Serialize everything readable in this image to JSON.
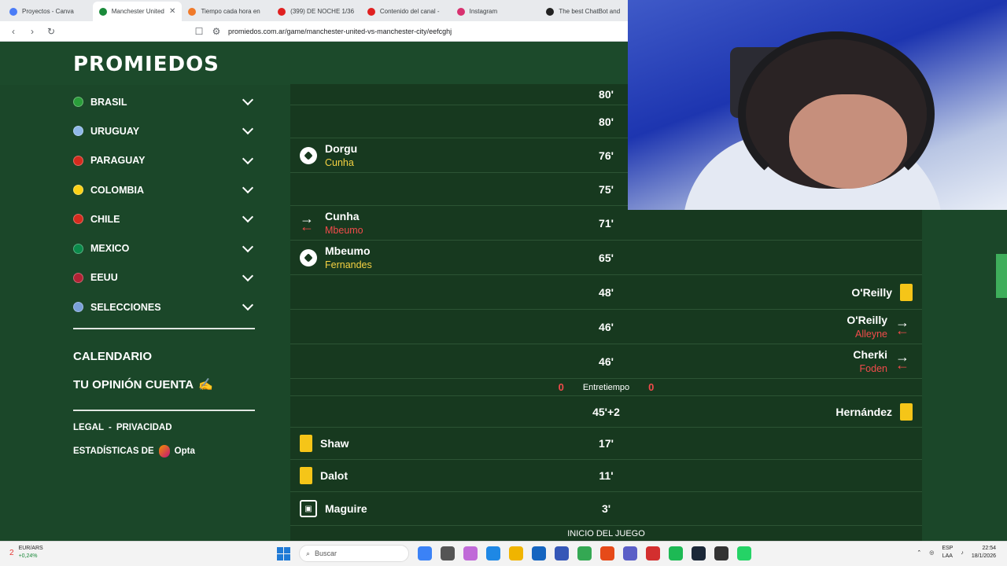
{
  "browser": {
    "tabs": [
      {
        "label": "Proyectos - Canva",
        "color": "#4a7cf7",
        "active": false
      },
      {
        "label": "Manchester United",
        "color": "#1a8a3a",
        "active": true
      },
      {
        "label": "Tiempo cada hora en",
        "color": "#f07a2a",
        "active": false
      },
      {
        "label": "(399) DE NOCHE 1/36",
        "color": "#e02020",
        "active": false
      },
      {
        "label": "Contenido del canal -",
        "color": "#e02020",
        "active": false
      },
      {
        "label": "Instagram",
        "color": "#d8316f",
        "active": false
      },
      {
        "label": "The best ChatBot and",
        "color": "#222222",
        "active": false
      }
    ],
    "close_glyph": "✕",
    "url": "promiedos.com.ar/game/manchester-united-vs-manchester-city/eefcghj"
  },
  "logo": "PROMIEDOS",
  "sidebar": {
    "countries": [
      {
        "label": "BRASIL",
        "flag": "#2a9d3a"
      },
      {
        "label": "URUGUAY",
        "flag": "#8fb8e8"
      },
      {
        "label": "PARAGUAY",
        "flag": "#d52b1e"
      },
      {
        "label": "COLOMBIA",
        "flag": "#fcd116"
      },
      {
        "label": "CHILE",
        "flag": "#d52b1e"
      },
      {
        "label": "MEXICO",
        "flag": "#0b8a4a"
      },
      {
        "label": "EEUU",
        "flag": "#b22234"
      },
      {
        "label": "SELECCIONES",
        "flag": "#7aa0d8"
      }
    ],
    "calendario": "CALENDARIO",
    "opinion": "TU OPINIÓN CUENTA",
    "opinion_emoji": "✍",
    "legal": "LEGAL",
    "separator": "-",
    "privacidad": "PRIVACIDAD",
    "stats": "ESTADÍSTICAS DE",
    "opta": "Opta"
  },
  "events": [
    {
      "minute": "80'",
      "home": null,
      "away": null
    },
    {
      "minute": "80'",
      "home": null,
      "away": null
    },
    {
      "minute": "76'",
      "home": {
        "icon": "goal",
        "name": "Dorgu",
        "sub": "Cunha",
        "sub_color": "yellow"
      },
      "away": null
    },
    {
      "minute": "75'",
      "home": null,
      "away": null
    },
    {
      "minute": "71'",
      "home": {
        "icon": "sub",
        "name": "Cunha",
        "sub": "Mbeumo",
        "sub_color": "red"
      },
      "away": null
    },
    {
      "minute": "65'",
      "home": {
        "icon": "goal",
        "name": "Mbeumo",
        "sub": "Fernandes",
        "sub_color": "yellow"
      },
      "away": null
    },
    {
      "minute": "48'",
      "home": null,
      "away": {
        "icon": "card",
        "name": "O'Reilly",
        "sub": null
      }
    },
    {
      "minute": "46'",
      "home": null,
      "away": {
        "icon": "sub",
        "name": "O'Reilly",
        "sub": "Alleyne",
        "sub_color": "red"
      }
    },
    {
      "minute": "46'",
      "home": null,
      "away": {
        "icon": "sub",
        "name": "Cherki",
        "sub": "Foden",
        "sub_color": "red"
      }
    },
    {
      "halftime": true,
      "label": "Entretiempo",
      "home_score": "0",
      "away_score": "0"
    },
    {
      "minute": "45'+2",
      "home": null,
      "away": {
        "icon": "card",
        "name": "Hernández",
        "sub": null
      }
    },
    {
      "minute": "17'",
      "home": {
        "icon": "card",
        "name": "Shaw",
        "sub": null
      },
      "away": null
    },
    {
      "minute": "11'",
      "home": {
        "icon": "card",
        "name": "Dalot",
        "sub": null
      },
      "away": null
    },
    {
      "minute": "3'",
      "home": {
        "icon": "var",
        "name": "Maguire",
        "sub": null
      },
      "away": null
    }
  ],
  "start_label": "INICIO DEL JUEGO",
  "taskbar": {
    "ticker": "EUR/ARS",
    "ticker_change": "+0,24%",
    "badge": "2",
    "search": "Buscar",
    "lang_top": "ESP",
    "lang_bottom": "LAA",
    "time": "22:54",
    "date": "18/1/2026",
    "apps": [
      "#3b82f6",
      "#555555",
      "#c06ad8",
      "#1e88e5",
      "#f0b400",
      "#1565c0",
      "#3557b7",
      "#34a853",
      "#e64a19",
      "#5b5fc7",
      "#d32f2f",
      "#1db954",
      "#1b2838",
      "#333333",
      "#25d366"
    ]
  }
}
